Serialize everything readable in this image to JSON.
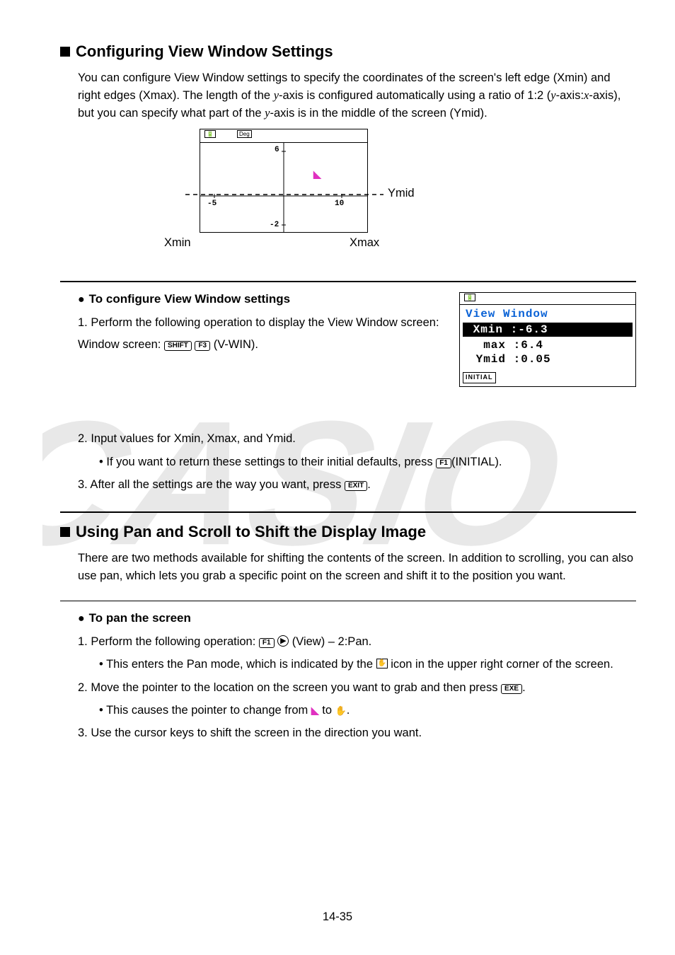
{
  "section1": {
    "heading": "Configuring View Window Settings",
    "intro_pre": "You can configure View Window settings to specify the coordinates of the screen's left edge (Xmin) and right edges (Xmax). The length of the ",
    "intro_y1": "y",
    "intro_mid1": "-axis is configured automatically using a ratio of 1:2 (",
    "intro_y2": "y",
    "intro_mid2": "-axis:",
    "intro_x": "x",
    "intro_mid3": "-axis), but you can specify what part of the ",
    "intro_y3": "y",
    "intro_end": "-axis is in the middle of the screen (Ymid)."
  },
  "diagram": {
    "n_top": "6",
    "n_left": "-5",
    "n_right": "10",
    "n_bot": "-2",
    "lbl_ymid": "Ymid",
    "lbl_xmin": "Xmin",
    "lbl_xmax": "Xmax"
  },
  "sub1": {
    "heading": "To configure View Window settings",
    "s1a": "1. Perform the following operation to display the View Window screen: ",
    "s1_k1": "SHIFT",
    "s1_k2": "F3",
    "s1b": "(V-WIN).",
    "s2": "2. Input values for Xmin, Xmax, and Ymid.",
    "s2sub_a": "• If you want to return these settings to their initial defaults, press ",
    "s2sub_k": "F1",
    "s2sub_b": "(INITIAL).",
    "s3a": "3. After all the settings are the way you want, press ",
    "s3_k": "EXIT",
    "s3b": "."
  },
  "vw": {
    "title": "View Window",
    "r1": " Xmin :-6.3       ",
    "r2": "  max :6.4",
    "r3": " Ymid :0.05",
    "btn": "INITIAL"
  },
  "section2": {
    "heading": "Using Pan and Scroll to Shift the Display Image",
    "intro": "There are two methods available for shifting the contents of the screen. In addition to scrolling, you can also use pan, which lets you grab a specific point on the screen and shift it to the position you want."
  },
  "sub2": {
    "heading": "To pan the screen",
    "s1a": "1. Perform the following operation: ",
    "s1_k": "F1",
    "s1b": "(View) – 2:Pan.",
    "s1sub_a": "• This enters the Pan mode, which is indicated by the ",
    "s1sub_b": " icon in the upper right corner of the screen.",
    "s2a": "2. Move the pointer to the location on the screen you want to grab and then press ",
    "s2_k": "EXE",
    "s2b": ".",
    "s2sub_a": "• This causes the pointer to change from ",
    "s2sub_b": " to ",
    "s2sub_c": ".",
    "s3": "3. Use the cursor keys to shift the screen in the direction you want."
  },
  "pagenum": "14-35"
}
